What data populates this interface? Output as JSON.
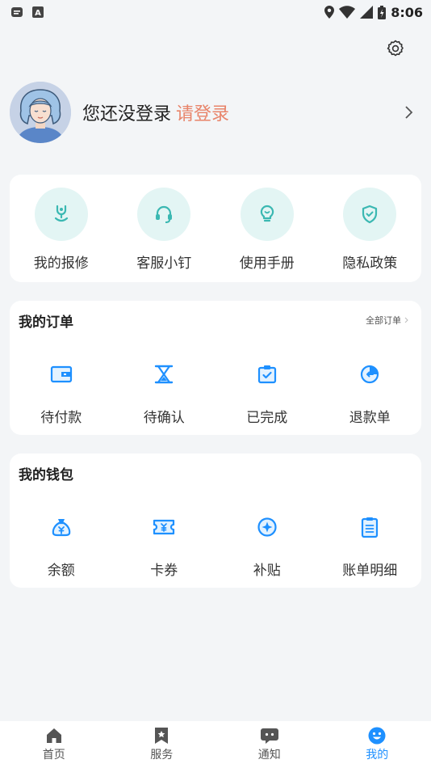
{
  "status_bar": {
    "time": "8:06"
  },
  "profile": {
    "login_text": "您还没登录",
    "login_link": "请登录"
  },
  "services": [
    {
      "label": "我的报修",
      "icon": "repair-icon"
    },
    {
      "label": "客服小钉",
      "icon": "headset-icon"
    },
    {
      "label": "使用手册",
      "icon": "lightbulb-icon"
    },
    {
      "label": "隐私政策",
      "icon": "shield-icon"
    }
  ],
  "orders": {
    "title": "我的订单",
    "more": "全部订单",
    "items": [
      {
        "label": "待付款",
        "icon": "wallet-icon"
      },
      {
        "label": "待确认",
        "icon": "hourglass-icon"
      },
      {
        "label": "已完成",
        "icon": "clipboard-check-icon"
      },
      {
        "label": "退款单",
        "icon": "refund-icon"
      }
    ]
  },
  "wallet": {
    "title": "我的钱包",
    "items": [
      {
        "label": "余额",
        "icon": "money-bag-icon"
      },
      {
        "label": "卡券",
        "icon": "ticket-icon"
      },
      {
        "label": "补贴",
        "icon": "subsidy-icon"
      },
      {
        "label": "账单明细",
        "icon": "bill-icon"
      }
    ]
  },
  "tabbar": [
    {
      "label": "首页",
      "icon": "home-icon"
    },
    {
      "label": "服务",
      "icon": "service-icon"
    },
    {
      "label": "通知",
      "icon": "message-icon"
    },
    {
      "label": "我的",
      "icon": "profile-smile-icon",
      "active": true
    }
  ],
  "colors": {
    "accent": "#1e90ff",
    "login_link": "#e8846a",
    "service_circle": "#e3f5f4",
    "service_icon": "#3bb8b2"
  }
}
